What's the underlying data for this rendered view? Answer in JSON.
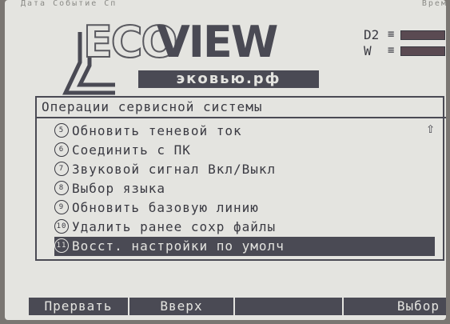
{
  "top_strip": {
    "left_text": "Дата  Событие  Сп",
    "right_text": "Время"
  },
  "brand": {
    "name_part1": "ECO",
    "name_part2": "VIEW",
    "subtitle": "эковью.рф"
  },
  "indicators": [
    {
      "label": "D2",
      "prefix": "≡"
    },
    {
      "label": "W",
      "prefix": "≡"
    }
  ],
  "menu": {
    "title": "Операции сервисной системы",
    "scroll_indicator": "⇧",
    "items": [
      {
        "num": "5",
        "label": "Обновить теневой ток",
        "selected": false
      },
      {
        "num": "6",
        "label": "Соединить с ПК",
        "selected": false
      },
      {
        "num": "7",
        "label": "Звуковой сигнал Вкл/Выкл",
        "selected": false
      },
      {
        "num": "8",
        "label": "Выбор языка",
        "selected": false
      },
      {
        "num": "9",
        "label": "Обновить базовую линию",
        "selected": false
      },
      {
        "num": "10",
        "label": "Удалить ранее сохр файлы",
        "selected": false
      },
      {
        "num": "11",
        "label": "Восст. настройки по умолч",
        "selected": true
      }
    ]
  },
  "softkeys": [
    "Прервать",
    "Вверх",
    "",
    "Выбор"
  ],
  "colors": {
    "screen": "#e4e4e0",
    "ink": "#4a4a54",
    "bezel": "#7a7672"
  }
}
